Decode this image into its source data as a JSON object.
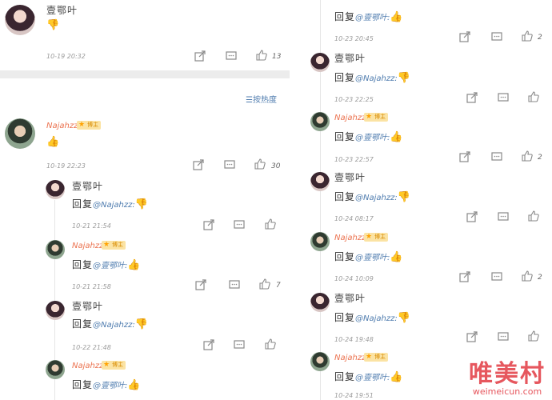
{
  "names": {
    "female": "壹鄂叶",
    "male": "Najahzz"
  },
  "badge_label": "博主",
  "reply_prefix": "回复",
  "mention_female": "@壹鄂叶:",
  "mention_male": "@Najahzz:",
  "sort_label": "按热度",
  "left": {
    "top_comment": {
      "time": "10-19 20:32",
      "likes": "13"
    },
    "main_comment": {
      "time": "10-19 22:23",
      "likes": "30"
    },
    "replies": [
      {
        "time": "10-21 21:54",
        "likes": ""
      },
      {
        "time": "10-21 21:58",
        "likes": "7"
      },
      {
        "time": "10-22 21:48",
        "likes": ""
      },
      {
        "time": "",
        "likes": ""
      }
    ]
  },
  "right": {
    "replies": [
      {
        "time": "10-23 20:45",
        "likes": "2"
      },
      {
        "time": "10-23 22:25",
        "likes": ""
      },
      {
        "time": "10-23 22:57",
        "likes": "2"
      },
      {
        "time": "10-24 08:17",
        "likes": ""
      },
      {
        "time": "10-24 10:09",
        "likes": "2"
      },
      {
        "time": "10-24 19:48",
        "likes": ""
      },
      {
        "time": "10-24 19:51",
        "likes": ""
      }
    ]
  },
  "icons": [
    "share-icon",
    "comment-icon",
    "like-icon",
    "thumbs-up-emoji",
    "thumbs-down-emoji"
  ],
  "watermark": {
    "cn": "唯美村",
    "en": "weimeicun.com"
  },
  "colors": {
    "orange_name": "#eb7350",
    "link_blue": "#507daf",
    "watermark_red": "#e6575e"
  }
}
